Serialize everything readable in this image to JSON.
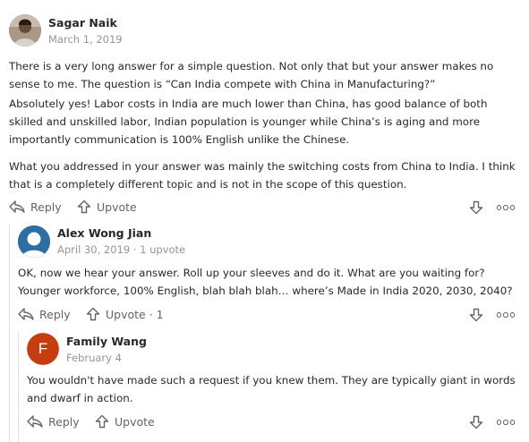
{
  "comments": [
    {
      "author": "Sagar Naik",
      "date": "March 1, 2019",
      "paragraphs": [
        "There is a very long answer for a simple question. Not only that but your answer makes no sense to me. The question is “Can India compete with China in Manufacturing?”",
        "Absolutely yes! Labor costs in India are much lower than China, has good balance of both skilled and unskilled labor, Indian population is younger while China’s is aging and more importantly communication is 100% English unlike the Chinese.",
        "What you addressed in your answer was mainly the switching costs from China to India. I think that is a completely different topic and is not in the scope of this question."
      ],
      "reply_label": "Reply",
      "upvote_label": "Upvote"
    },
    {
      "author": "Alex Wong Jian",
      "meta": "April 30, 2019 · 1 upvote",
      "paragraphs": [
        "OK, now we hear your answer. Roll up your sleeves and do it. What are you waiting for? Younger workforce, 100% English, blah blah blah… where’s Made in India 2020, 2030, 2040?"
      ],
      "reply_label": "Reply",
      "upvote_label": "Upvote · 1"
    },
    {
      "author": "Family Wang",
      "date": "February 4",
      "avatar_letter": "F",
      "avatar_color": "#c63e10",
      "paragraphs": [
        "You wouldn't have made such a request if you knew them. They are typically giant in words and dwarf in action."
      ],
      "reply_label": "Reply",
      "upvote_label": "Upvote"
    }
  ],
  "colors": {
    "text": "#282829",
    "meta": "#939598",
    "action": "#636466",
    "line": "#dee0e1",
    "avatar_blue": "#2f6ea5"
  }
}
